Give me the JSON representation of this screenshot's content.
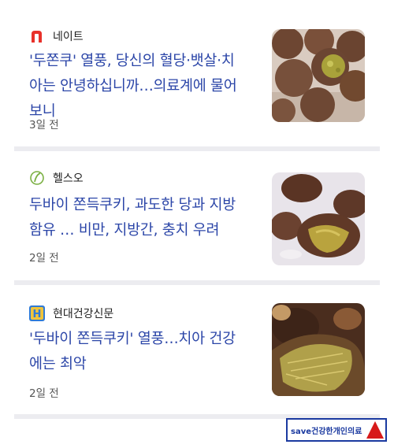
{
  "articles": [
    {
      "source": "네이트",
      "title_line1": "'두쫀쿠' 열풍, 당신의 혈당·뱃살·치",
      "title_line2": "아는 안녕하십니까…의료계에 물어",
      "title_line3": "보니",
      "time": "3일 전",
      "logo_icon": "nate-logo-icon",
      "logo_color": "#e8312a"
    },
    {
      "source": "헬스오",
      "title_line1": "두바이 쫀득쿠키, 과도한 당과 지방",
      "title_line2": "함유 … 비만, 지방간, 충치 우려",
      "time": "2일 전",
      "logo_icon": "healtho-logo-icon",
      "logo_color": "#7bb043"
    },
    {
      "source": "현대건강신문",
      "title_line1": "'두바이 쫀득쿠키' 열풍…치아 건강",
      "title_line2": "에는 최악",
      "time": "2일 전",
      "logo_icon": "hyundai-health-logo-icon",
      "logo_color": "#2f7ad6"
    }
  ],
  "watermark": {
    "text": "save건강한개인의료"
  },
  "colors": {
    "title": "#2c46a8",
    "divider": "#ececf0"
  }
}
